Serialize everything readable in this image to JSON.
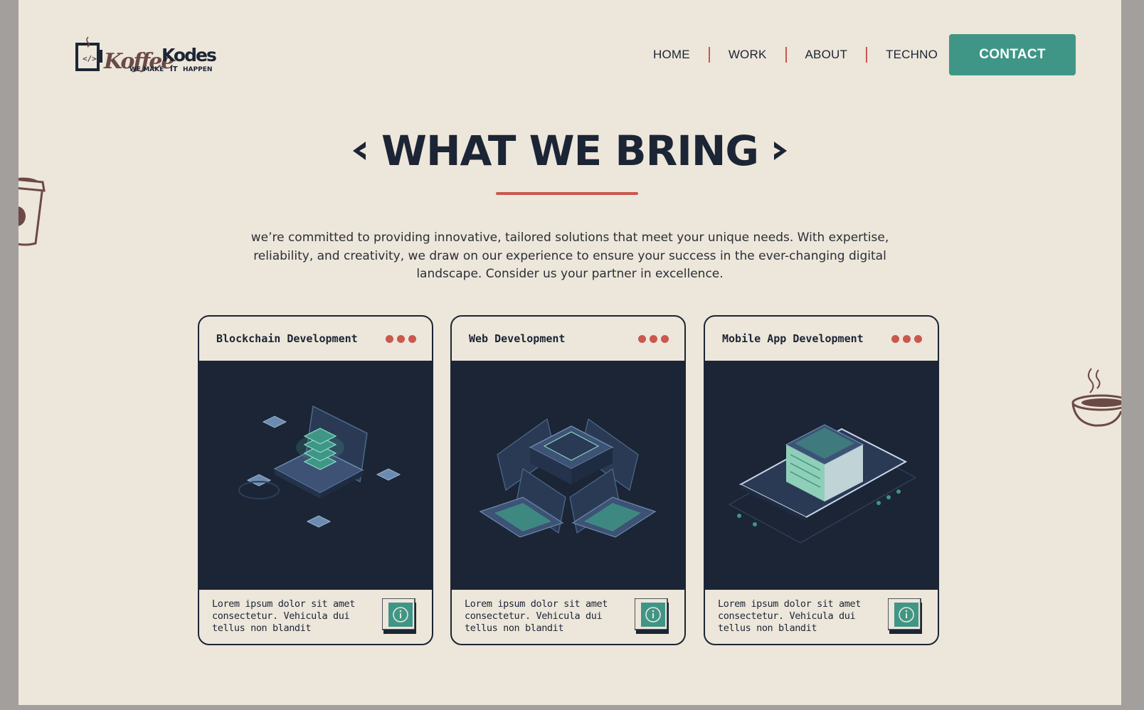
{
  "brand": {
    "name_part1": "Koffee",
    "name_part2": "Kodes",
    "tagline_part1": "WE MAKE",
    "tagline_part2": "IT",
    "tagline_part3": "HAPPEN",
    "logo_glyph": "</>"
  },
  "nav": {
    "items": [
      {
        "label": "HOME"
      },
      {
        "label": "WORK"
      },
      {
        "label": "ABOUT"
      },
      {
        "label": "TECHNO"
      }
    ],
    "contact_label": "CONTACT"
  },
  "hero": {
    "title": "WHAT WE BRING",
    "intro": "we’re committed to providing innovative, tailored solutions that meet your unique needs. With expertise, reliability, and creativity, we draw on our experience to ensure your success in the ever-changing digital landscape. Consider us your partner in excellence."
  },
  "cards": [
    {
      "title": "Blockchain Development",
      "description": "Lorem ipsum dolor sit amet consectetur. Vehicula dui tellus non blandit",
      "illustration": "blockchain-server-laptop-illustration"
    },
    {
      "title": "Web Development",
      "description": "Lorem ipsum dolor sit amet consectetur. Vehicula dui tellus non blandit",
      "illustration": "server-with-laptops-illustration"
    },
    {
      "title": "Mobile App Development",
      "description": "Lorem ipsum dolor sit amet consectetur. Vehicula dui tellus non blandit",
      "illustration": "phone-with-building-illustration"
    }
  ],
  "colors": {
    "background": "#ede6da",
    "navy": "#1b2535",
    "accent_red": "#c9584e",
    "accent_teal": "#3f9686",
    "coffee_brown": "#6b4a45"
  },
  "icons": [
    "info-icon",
    "chevron-left-icon",
    "chevron-right-icon",
    "coffee-cup-icon",
    "coffee-mug-icon"
  ]
}
